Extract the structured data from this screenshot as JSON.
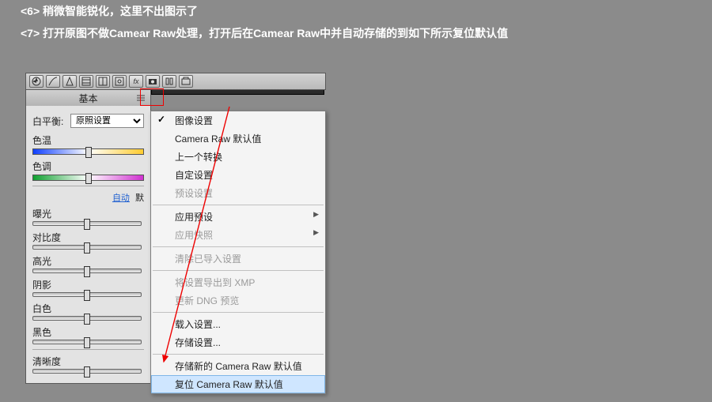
{
  "instructions": {
    "line6": "<6>  稍微智能锐化，这里不出图示了",
    "line7": "<7>  打开原图不做Camear Raw处理，打开后在Camear Raw中并自动存储的到如下所示复位默认值"
  },
  "panel": {
    "tab_basic": "基本",
    "wb_label": "白平衡:",
    "wb_value": "原照设置",
    "temperature_label": "色温",
    "tint_label": "色调",
    "auto_link": "自动",
    "default_text": "默",
    "sliders": {
      "exposure": "曝光",
      "contrast": "对比度",
      "highlights": "高光",
      "shadows": "阴影",
      "whites": "白色",
      "blacks": "黑色",
      "clarity": "清晰度"
    }
  },
  "menu": {
    "image_settings": "图像设置",
    "cr_defaults": "Camera Raw 默认值",
    "prev_conversion": "上一个转换",
    "custom_settings": "自定设置",
    "preset_settings": "预设设置",
    "apply_preset": "应用预设",
    "apply_snapshot": "应用快照",
    "clear_imported": "清除已导入设置",
    "export_xmp": "将设置导出到 XMP",
    "update_dng": "更新 DNG 预览",
    "load_settings": "载入设置...",
    "save_settings": "存储设置...",
    "save_new_defaults": "存储新的 Camera Raw 默认值",
    "reset_defaults": "复位 Camera Raw 默认值"
  }
}
